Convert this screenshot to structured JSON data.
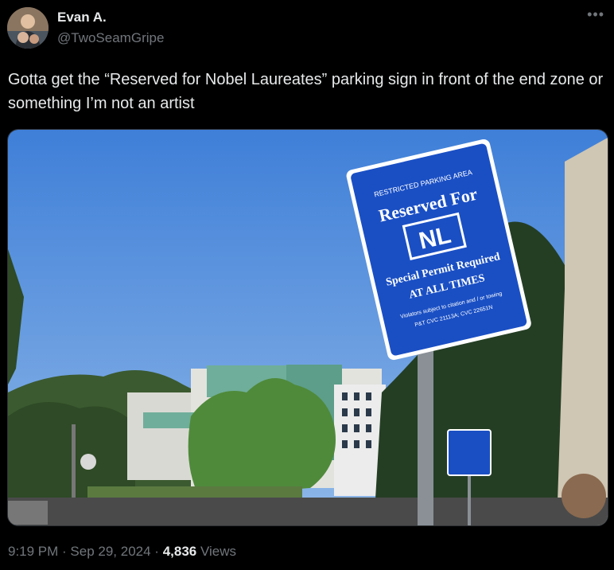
{
  "author": {
    "display_name": "Evan A.",
    "handle": "@TwoSeamGripe",
    "avatar_icon": "profile-photo"
  },
  "more_icon": "ellipsis-icon",
  "tweet": {
    "text": "Gotta get the “Reserved for Nobel Laureates” parking sign in front of the end zone or something I’m not an artist"
  },
  "sign": {
    "line1": "RESTRICTED PARKING AREA",
    "line2": "Reserved For",
    "line3": "NL",
    "line4": "Special Permit Required",
    "line5": "AT ALL TIMES",
    "line6": "Violators subject to citation and / or towing",
    "line7": "P&T CVC 21113A; CVC 22651N",
    "color": "#1a4fc4"
  },
  "meta": {
    "time": "9:19 PM",
    "separator": " · ",
    "date": "Sep 29, 2024",
    "views_count": "4,836",
    "views_label": "Views"
  }
}
